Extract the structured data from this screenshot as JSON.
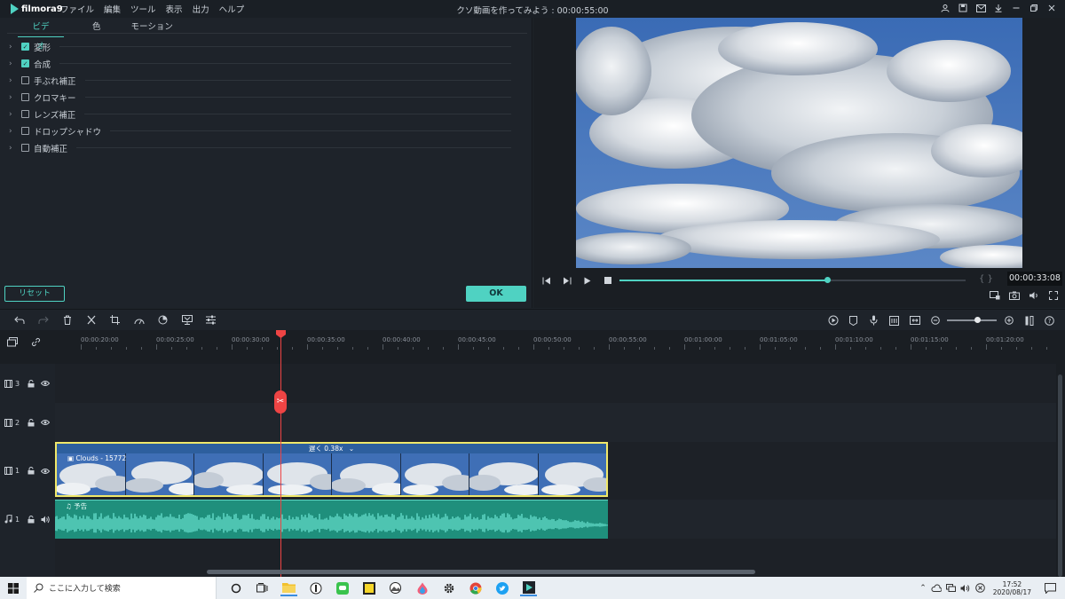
{
  "app": {
    "logo": "filmora9",
    "menu": [
      "ファイル",
      "編集",
      "ツール",
      "表示",
      "出力",
      "ヘルプ"
    ],
    "title": "クソ動画を作ってみよう : 00:00:55:00"
  },
  "left_panel": {
    "tabs": [
      "ビデオ",
      "色",
      "モーション"
    ],
    "active_tab": "ビデオ",
    "properties": [
      {
        "label": "変形",
        "checked": true
      },
      {
        "label": "合成",
        "checked": true
      },
      {
        "label": "手ぶれ補正",
        "checked": false
      },
      {
        "label": "クロマキー",
        "checked": false
      },
      {
        "label": "レンズ補正",
        "checked": false
      },
      {
        "label": "ドロップシャドウ",
        "checked": false
      },
      {
        "label": "自動補正",
        "checked": false
      }
    ],
    "reset_label": "リセット",
    "ok_label": "OK"
  },
  "preview": {
    "timecode": "00:00:33:08",
    "braces": "{ }",
    "progress": 0.6
  },
  "timeline": {
    "ruler": [
      "00:00:20:00",
      "00:00:25:00",
      "00:00:30:00",
      "00:00:35:00",
      "00:00:40:00",
      "00:00:45:00",
      "00:00:50:00",
      "00:00:55:00",
      "00:01:00:00",
      "00:01:05:00",
      "00:01:10:00",
      "00:01:15:00",
      "00:01:20:00"
    ],
    "tracks": [
      {
        "label": "3",
        "kind": "video"
      },
      {
        "label": "2",
        "kind": "video"
      },
      {
        "label": "1",
        "kind": "video"
      },
      {
        "label": "1",
        "kind": "audio"
      }
    ],
    "video_clip": {
      "speed": "遅く 0.38x",
      "name": "Clouds - 15772"
    },
    "audio_clip": {
      "name": "予告"
    },
    "zoom_level": 0.6
  },
  "taskbar": {
    "search_placeholder": "ここに入力して検索",
    "time": "17:52",
    "date": "2020/08/17"
  },
  "colors": {
    "accent": "#4fd2c2",
    "playhead": "#ee4444",
    "clip_border": "#f0e86a",
    "audio_clip": "#1f8f7c"
  }
}
